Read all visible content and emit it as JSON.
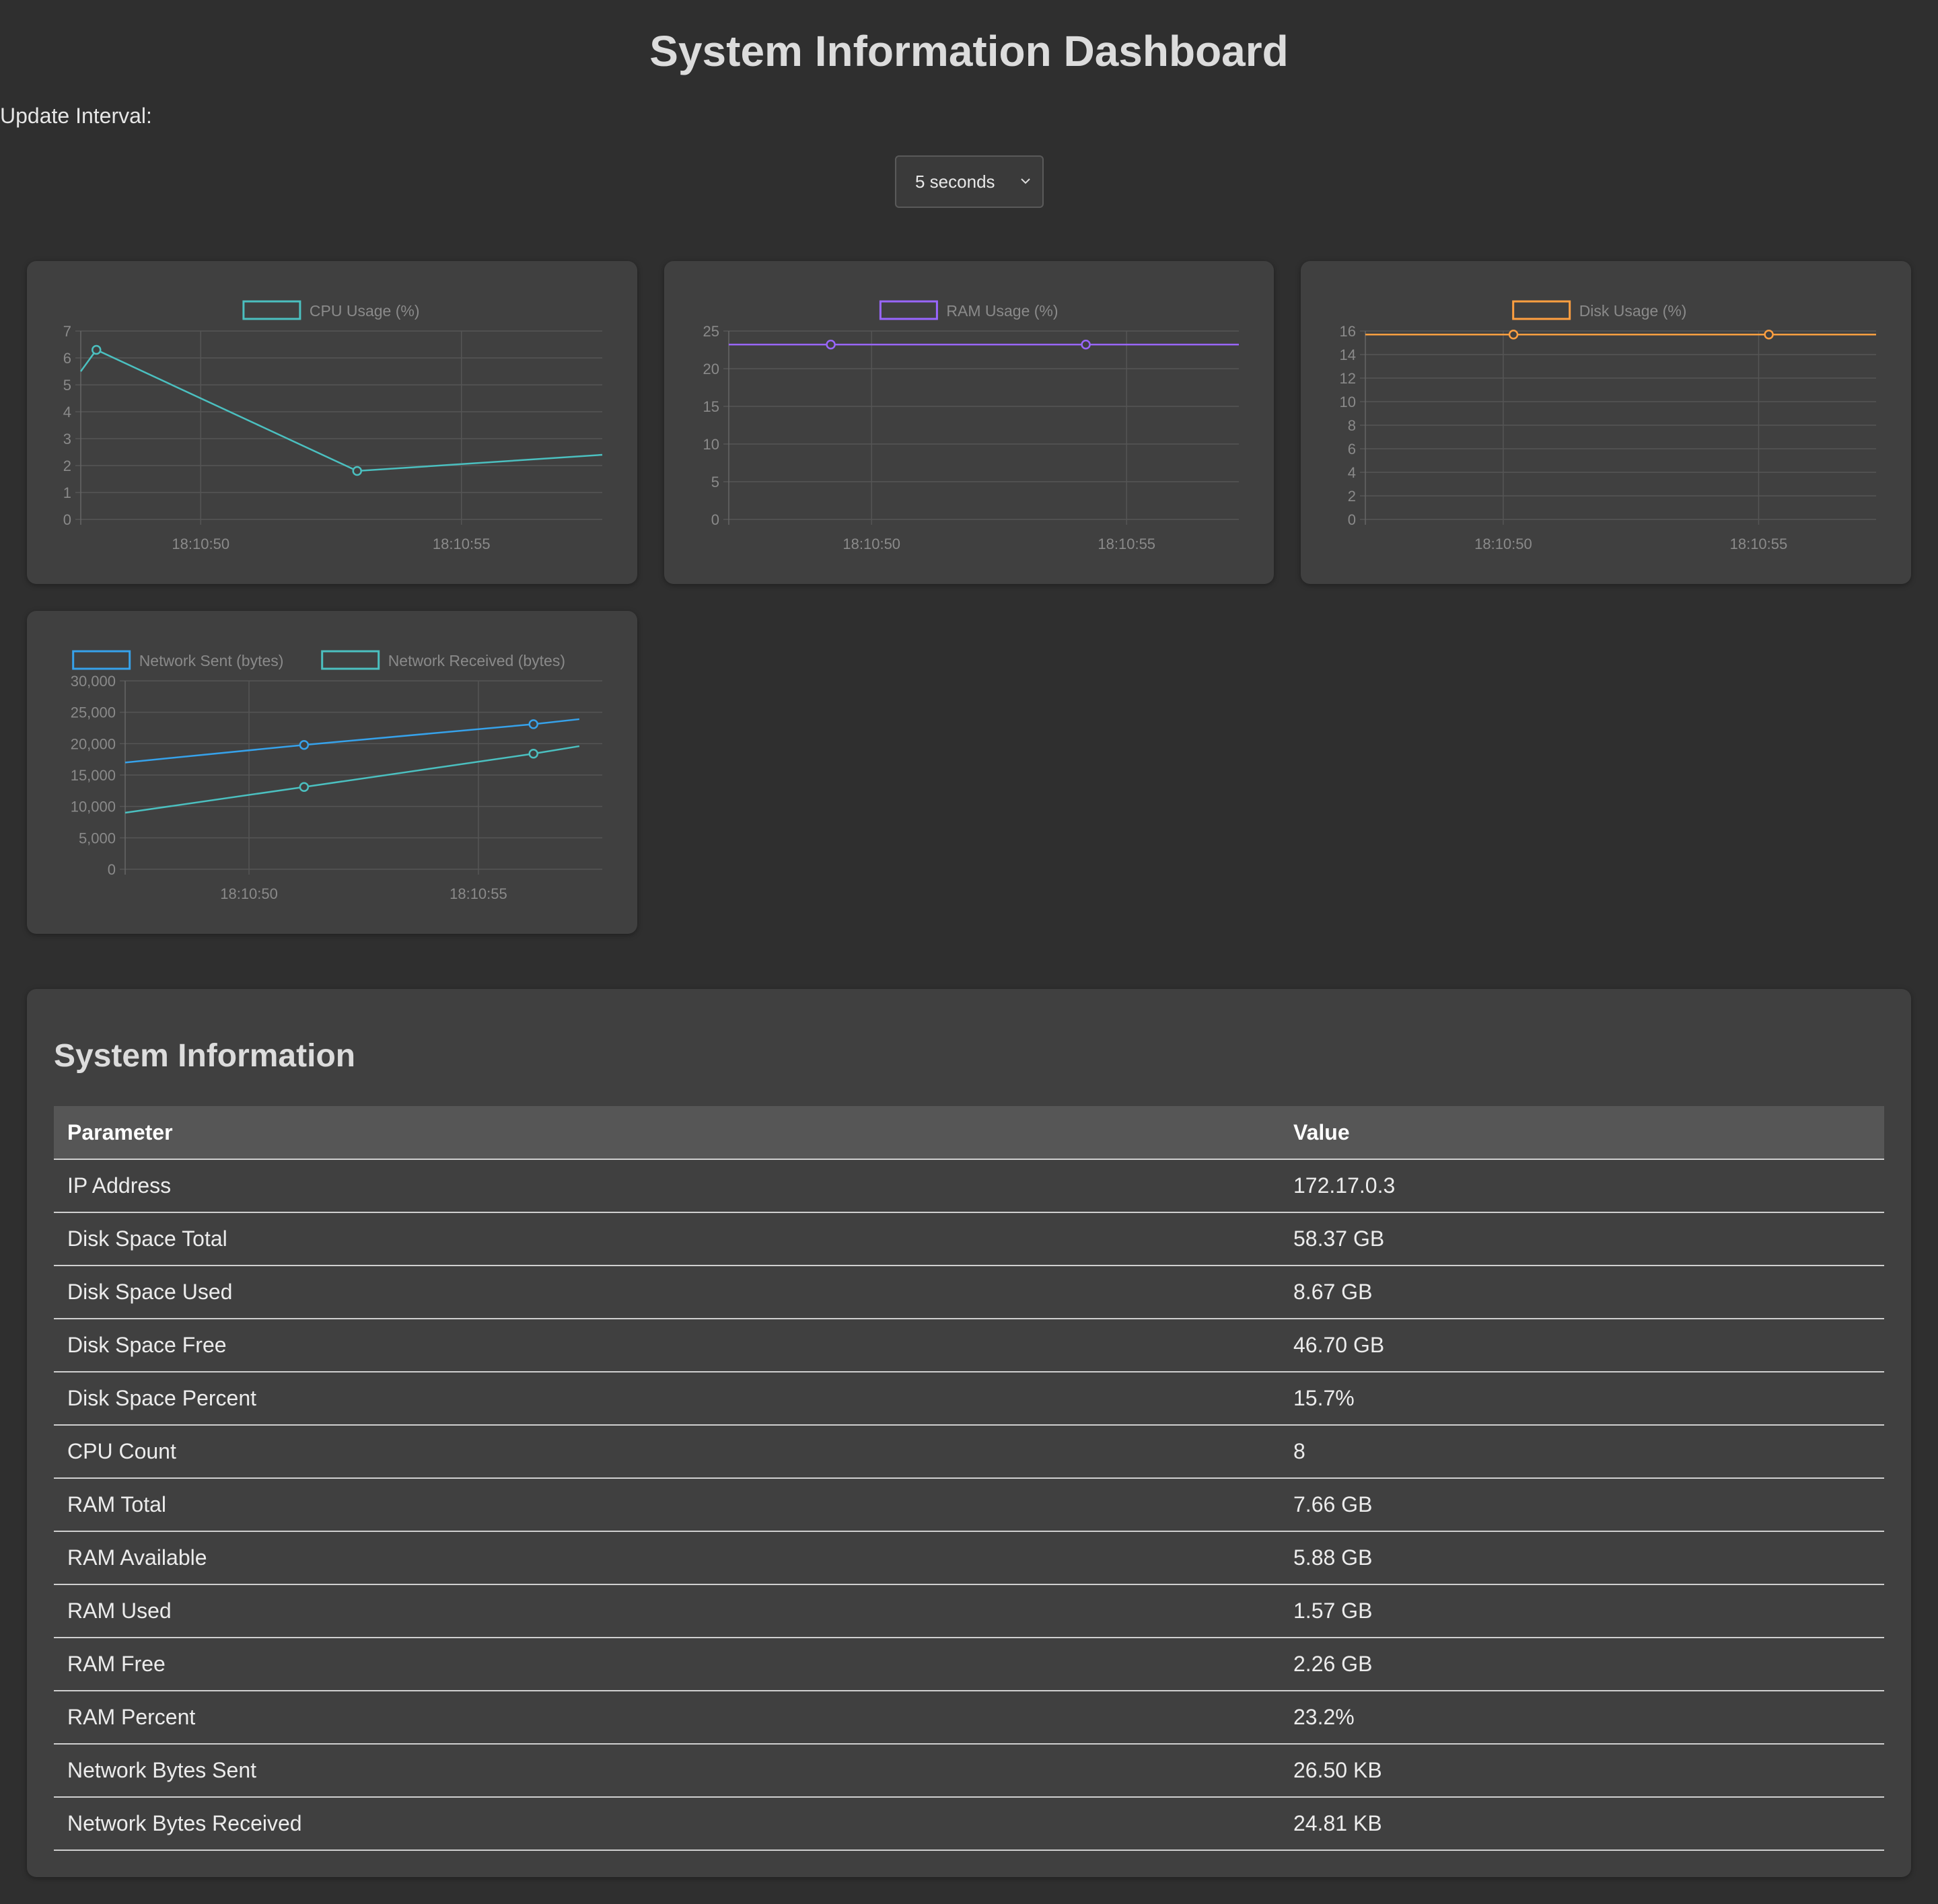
{
  "page_title": "System Information Dashboard",
  "update_interval": {
    "label": "Update Interval:",
    "selected": "5 seconds"
  },
  "colors": {
    "background": "#2f2f2f",
    "card": "#404040",
    "cpu": "#4bc0c0",
    "ram": "#9966ff",
    "disk": "#ff9f40",
    "net_sent": "#36a2eb",
    "net_received": "#4bc0c0"
  },
  "chart_data": [
    {
      "type": "line",
      "x_ticks": [
        "18:10:50",
        "18:10:55"
      ],
      "series": [
        {
          "name": "CPU Usage (%)",
          "x": [
            "18:10:47.7",
            "18:10:48.0",
            "18:10:53.0",
            "18:10:57.7"
          ],
          "values": [
            5.5,
            6.3,
            1.8,
            2.4
          ]
        }
      ],
      "ylim": [
        0,
        7
      ],
      "y_ticks": [
        "0",
        "1",
        "2",
        "3",
        "4",
        "5",
        "6",
        "7"
      ],
      "legend": "top",
      "grid": true
    },
    {
      "type": "line",
      "x_ticks": [
        "18:10:50",
        "18:10:55"
      ],
      "series": [
        {
          "name": "RAM Usage (%)",
          "x": [
            "18:10:47.2",
            "18:10:49.2",
            "18:10:54.2",
            "18:10:57.2"
          ],
          "values": [
            23.2,
            23.2,
            23.2,
            23.2
          ]
        }
      ],
      "ylim": [
        0,
        25
      ],
      "y_ticks": [
        "0",
        "5",
        "10",
        "15",
        "20",
        "25"
      ],
      "legend": "top",
      "grid": true
    },
    {
      "type": "line",
      "x_ticks": [
        "18:10:50",
        "18:10:55"
      ],
      "series": [
        {
          "name": "Disk Usage (%)",
          "x": [
            "18:10:47.3",
            "18:10:50.2",
            "18:10:55.2",
            "18:10:57.3"
          ],
          "values": [
            15.7,
            15.7,
            15.7,
            15.7
          ]
        }
      ],
      "ylim": [
        0,
        16
      ],
      "y_ticks": [
        "0",
        "2",
        "4",
        "6",
        "8",
        "10",
        "12",
        "14",
        "16"
      ],
      "legend": "top",
      "grid": true
    },
    {
      "type": "line",
      "x_ticks": [
        "18:10:50",
        "18:10:55"
      ],
      "series": [
        {
          "name": "Network Sent (bytes)",
          "x": [
            "18:10:47.3",
            "18:10:51.2",
            "18:10:56.2",
            "18:10:57.2"
          ],
          "values": [
            17000,
            19800,
            23100,
            23900
          ]
        },
        {
          "name": "Network Received (bytes)",
          "x": [
            "18:10:47.3",
            "18:10:51.2",
            "18:10:56.2",
            "18:10:57.2"
          ],
          "values": [
            9000,
            13100,
            18400,
            19600
          ]
        }
      ],
      "ylim": [
        0,
        30000
      ],
      "y_ticks": [
        "0",
        "5,000",
        "10,000",
        "15,000",
        "20,000",
        "25,000",
        "30,000"
      ],
      "legend": "top",
      "grid": true
    }
  ],
  "system_info": {
    "title": "System Information",
    "headers": [
      "Parameter",
      "Value"
    ],
    "rows": [
      [
        "IP Address",
        "172.17.0.3"
      ],
      [
        "Disk Space Total",
        "58.37 GB"
      ],
      [
        "Disk Space Used",
        "8.67 GB"
      ],
      [
        "Disk Space Free",
        "46.70 GB"
      ],
      [
        "Disk Space Percent",
        "15.7%"
      ],
      [
        "CPU Count",
        "8"
      ],
      [
        "RAM Total",
        "7.66 GB"
      ],
      [
        "RAM Available",
        "5.88 GB"
      ],
      [
        "RAM Used",
        "1.57 GB"
      ],
      [
        "RAM Free",
        "2.26 GB"
      ],
      [
        "RAM Percent",
        "23.2%"
      ],
      [
        "Network Bytes Sent",
        "26.50 KB"
      ],
      [
        "Network Bytes Received",
        "24.81 KB"
      ]
    ]
  }
}
